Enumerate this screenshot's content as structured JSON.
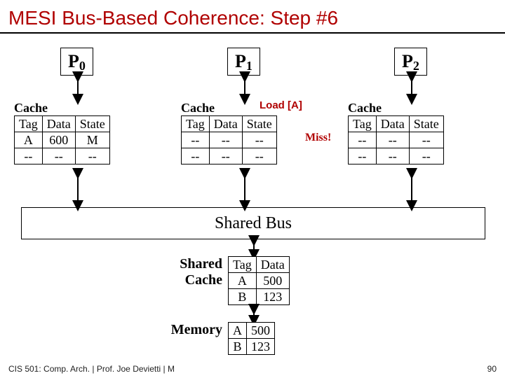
{
  "title": "MESI Bus-Based Coherence: Step #6",
  "processors": {
    "p0": {
      "label_main": "P",
      "label_sub": "0"
    },
    "p1": {
      "label_main": "P",
      "label_sub": "1"
    },
    "p2": {
      "label_main": "P",
      "label_sub": "2"
    }
  },
  "cache_label": "Cache",
  "headers": {
    "tag": "Tag",
    "data": "Data",
    "state": "State"
  },
  "caches": {
    "p0": [
      {
        "tag": "A",
        "data": "600",
        "state": "M"
      },
      {
        "tag": "--",
        "data": "--",
        "state": "--"
      }
    ],
    "p1": [
      {
        "tag": "--",
        "data": "--",
        "state": "--"
      },
      {
        "tag": "--",
        "data": "--",
        "state": "--"
      }
    ],
    "p2": [
      {
        "tag": "--",
        "data": "--",
        "state": "--"
      },
      {
        "tag": "--",
        "data": "--",
        "state": "--"
      }
    ]
  },
  "load_annotation": "Load [A]",
  "miss_annotation": "Miss!",
  "shared_bus_label": "Shared Bus",
  "shared_cache_label_l1": "Shared",
  "shared_cache_label_l2": "Cache",
  "shared_cache": [
    {
      "tag": "A",
      "data": "500"
    },
    {
      "tag": "B",
      "data": "123"
    }
  ],
  "memory_label": "Memory",
  "memory": [
    {
      "tag": "A",
      "data": "500"
    },
    {
      "tag": "B",
      "data": "123"
    }
  ],
  "footer_left": "CIS 501: Comp. Arch.  |  Prof. Joe Devietti  |  M",
  "footer_right": "90"
}
